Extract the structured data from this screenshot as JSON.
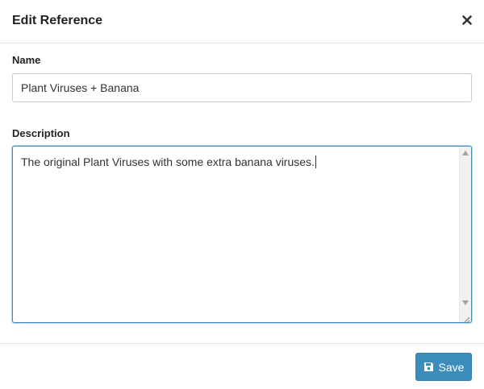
{
  "modal": {
    "title": "Edit Reference",
    "close_icon": "close-icon"
  },
  "form": {
    "name": {
      "label": "Name",
      "value": "Plant Viruses + Banana"
    },
    "description": {
      "label": "Description",
      "value": "The original Plant Viruses with some extra banana viruses."
    }
  },
  "footer": {
    "save_label": "Save",
    "save_icon": "floppy-disk-icon"
  },
  "colors": {
    "primary": "#3c8dbc",
    "focus_border": "#3c8dbc",
    "header_divider": "#e5e5e5",
    "text": "#333333"
  }
}
